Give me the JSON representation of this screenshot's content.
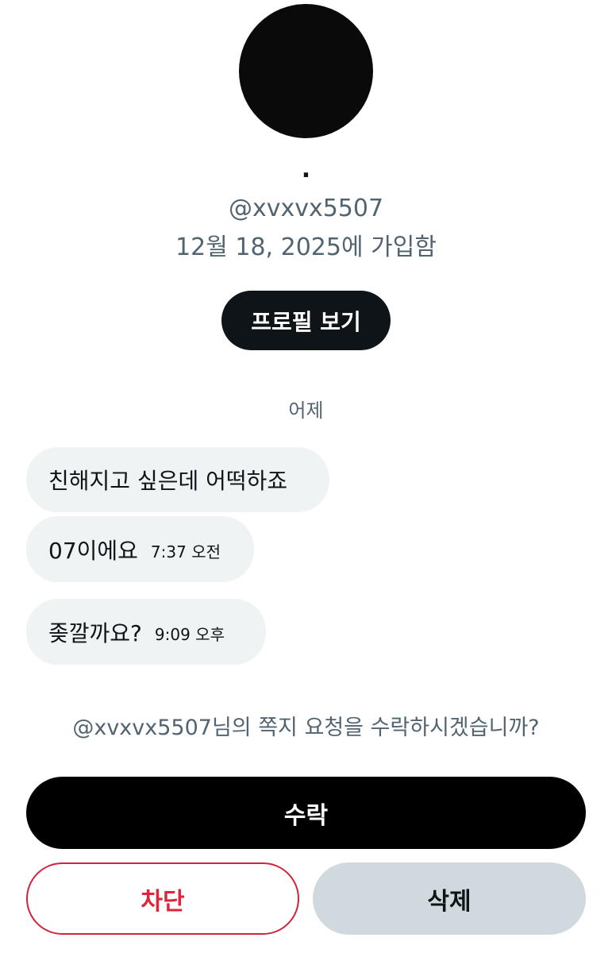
{
  "profile": {
    "display_name": ".",
    "handle": "@xvxvx5507",
    "joined": "12월 18, 2025에 가입함",
    "view_profile_label": "프로필 보기"
  },
  "conversation": {
    "day_label": "어제",
    "messages": [
      {
        "text": "친해지고 싶은데 어떡하죠",
        "time": ""
      },
      {
        "text": "07이에요",
        "time": "7:37 오전"
      },
      {
        "text": "좆깔까요?",
        "time": "9:09 오후"
      }
    ]
  },
  "request": {
    "question": "@xvxvx5507님의 쪽지 요청을 수락하시겠습니까?",
    "accept_label": "수락",
    "block_label": "차단",
    "delete_label": "삭제"
  },
  "colors": {
    "primary_text": "#0f1419",
    "secondary_text": "#536471",
    "bubble_bg": "#eff3f4",
    "danger": "#e0243b",
    "neutral_button": "#cfd9de"
  }
}
